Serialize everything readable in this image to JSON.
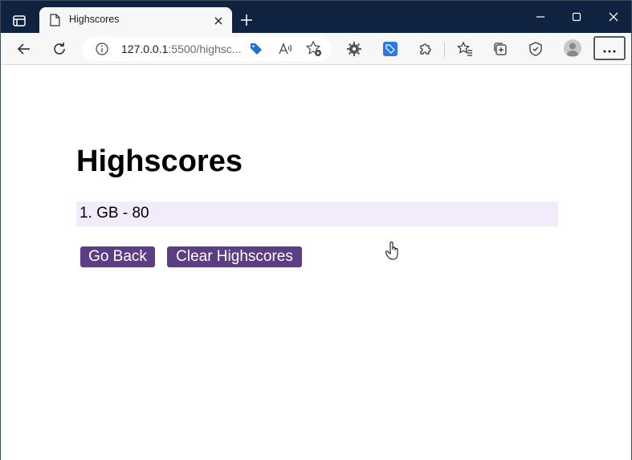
{
  "browser": {
    "tab": {
      "title": "Highscores"
    },
    "address": {
      "host": "127.0.0.1",
      "rest": ":5500/highsc..."
    }
  },
  "page": {
    "heading": "Highscores",
    "scores": [
      {
        "text": "1. GB - 80"
      }
    ],
    "buttons": {
      "go_back": "Go Back",
      "clear": "Clear Highscores"
    }
  },
  "colors": {
    "titlebar": "#0f2340",
    "button": "#5b3e84",
    "score_bg": "#f1ebfc"
  }
}
